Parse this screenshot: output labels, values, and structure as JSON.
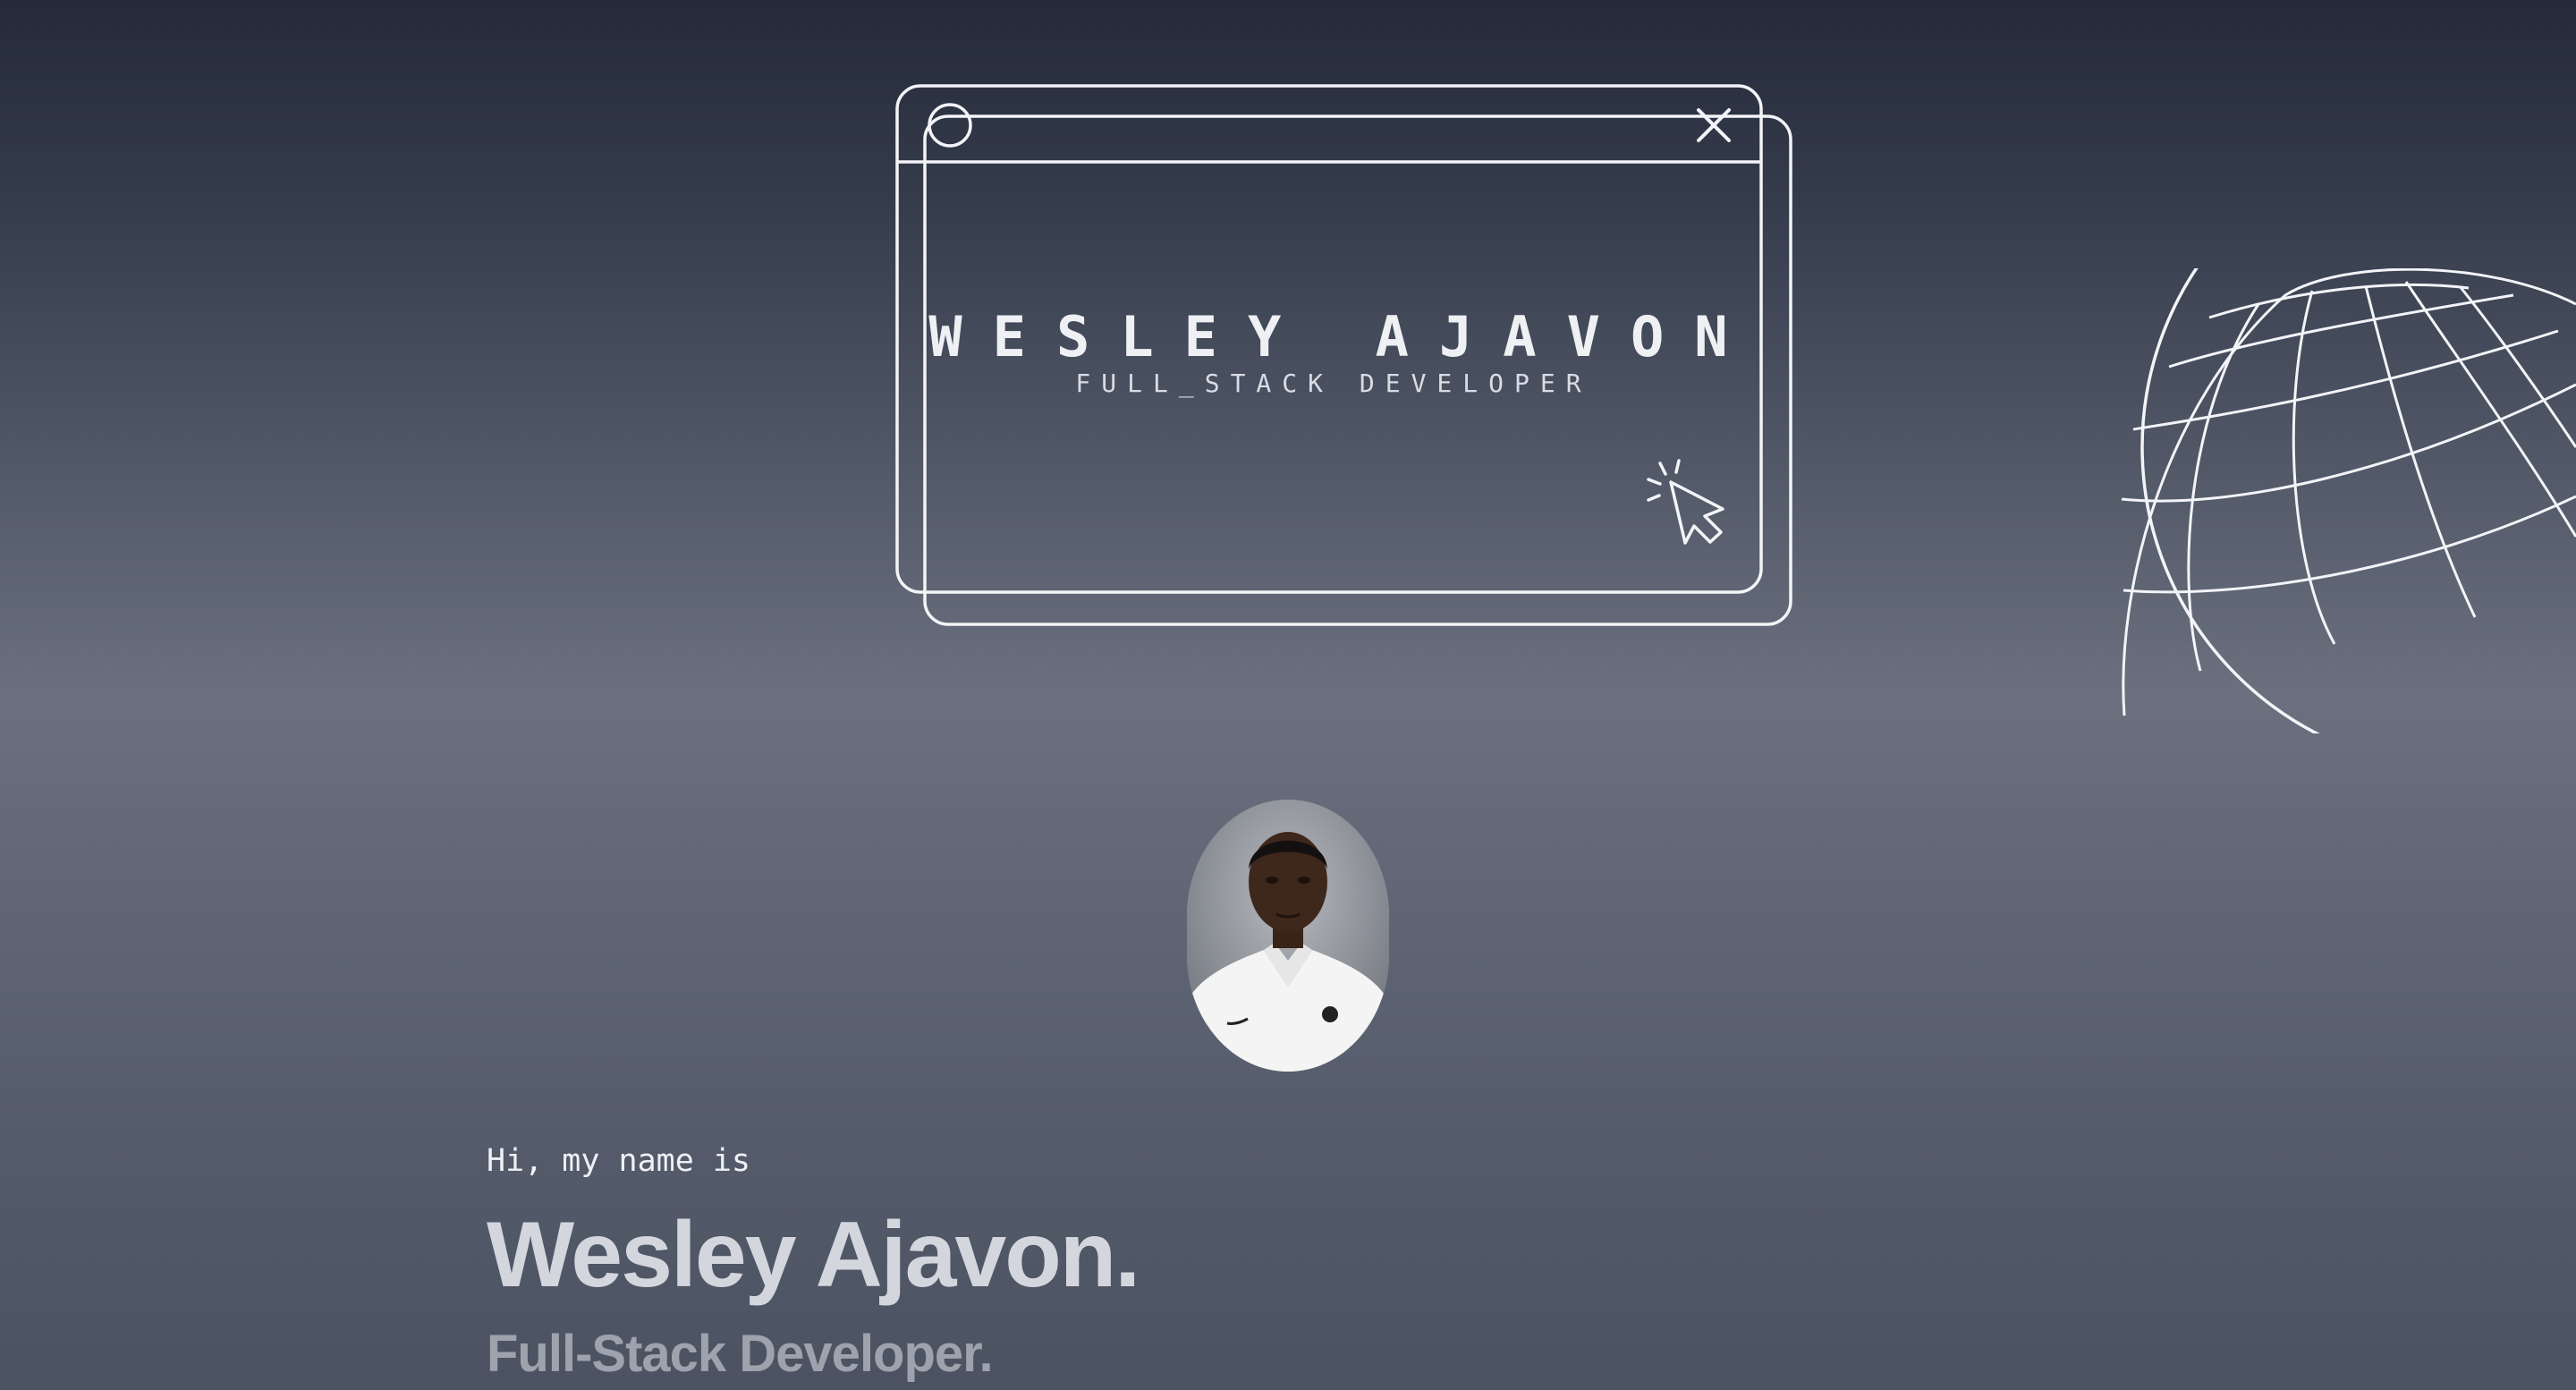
{
  "hero": {
    "title": "WESLEY AJAVON",
    "subtitle": "FULL_STACK DEVELOPER",
    "icons": [
      "circle-icon",
      "close-icon",
      "cursor-click-icon"
    ]
  },
  "decor": {
    "globe_icon": "globe-wireframe-icon"
  },
  "profile": {
    "avatar_alt": "Wesley Ajavon"
  },
  "intro": {
    "greeting": "Hi, my name is",
    "name": "Wesley Ajavon.",
    "role": "Full-Stack Developer."
  },
  "colors": {
    "line": "#f2f4f7",
    "text": "#eef0f4",
    "name": "#d3d6dd",
    "role": "#9da2ad"
  }
}
